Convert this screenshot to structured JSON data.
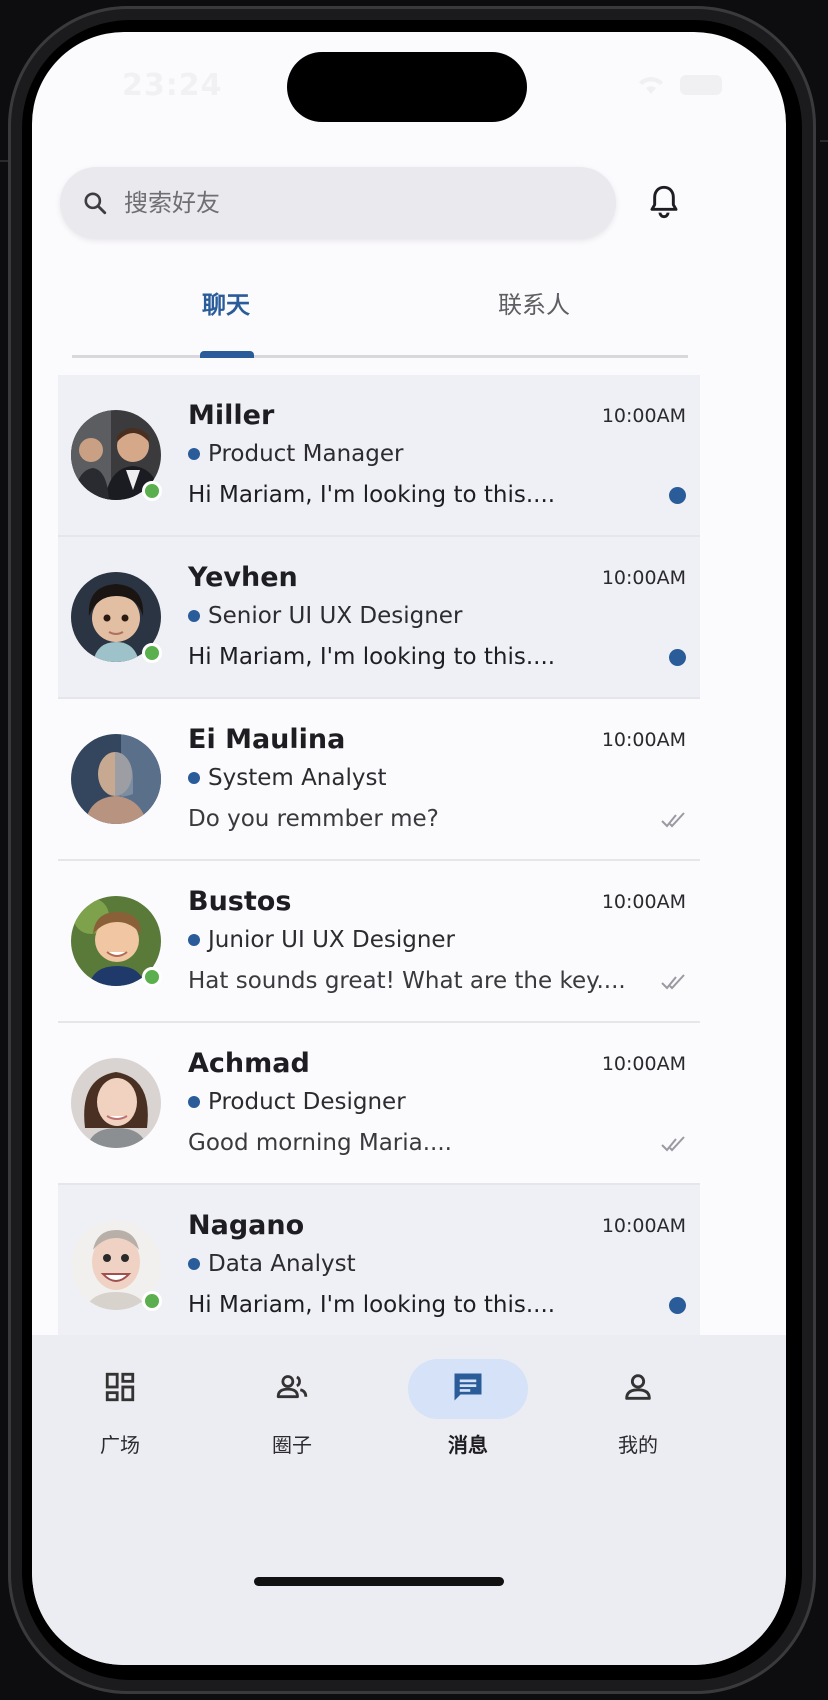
{
  "status_bar": {
    "time": "23:24"
  },
  "search": {
    "placeholder": "搜索好友"
  },
  "tabs": [
    {
      "label": "聊天",
      "active": true
    },
    {
      "label": "联系人",
      "active": false
    }
  ],
  "chats": [
    {
      "name": "Miller",
      "role": "Product Manager",
      "message": "Hi Mariam, I'm looking to this....",
      "time": "10:00AM",
      "unread": true,
      "online": true
    },
    {
      "name": "Yevhen",
      "role": "Senior UI UX Designer",
      "message": "Hi Mariam, I'm looking to this....",
      "time": "10:00AM",
      "unread": true,
      "online": true
    },
    {
      "name": "Ei Maulina",
      "role": "System Analyst",
      "message": "Do you remmber me?",
      "time": "10:00AM",
      "unread": false,
      "online": false
    },
    {
      "name": "Bustos",
      "role": "Junior UI UX Designer",
      "message": "Hat sounds great! What are the key....",
      "time": "10:00AM",
      "unread": false,
      "online": true
    },
    {
      "name": "Achmad",
      "role": "Product Designer",
      "message": "Good morning Maria....",
      "time": "10:00AM",
      "unread": false,
      "online": false
    },
    {
      "name": "Nagano",
      "role": "Data Analyst",
      "message": "Hi Mariam, I'm looking to this....",
      "time": "10:00AM",
      "unread": true,
      "online": true
    }
  ],
  "bottom_nav": [
    {
      "label": "广场",
      "icon": "dashboard-icon",
      "active": false
    },
    {
      "label": "圈子",
      "icon": "group-icon",
      "active": false
    },
    {
      "label": "消息",
      "icon": "message-icon",
      "active": true
    },
    {
      "label": "我的",
      "icon": "person-icon",
      "active": false
    }
  ],
  "colors": {
    "accent": "#2a5c9a",
    "online": "#5caf4f",
    "unread_row_bg": "#eff0f5",
    "nav_bg": "#ecedf2",
    "active_pill": "#d5e2f8"
  }
}
